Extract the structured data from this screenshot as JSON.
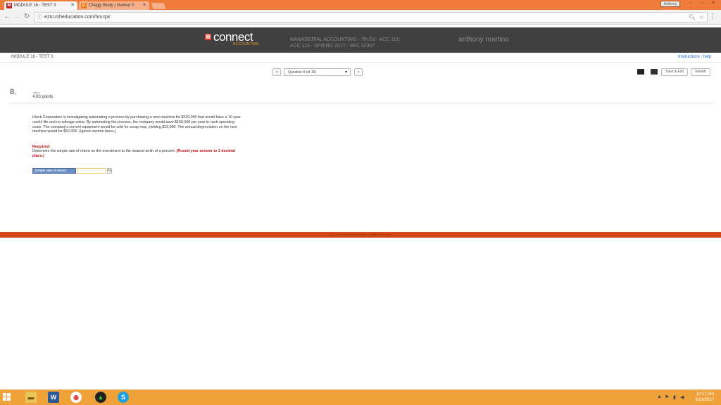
{
  "browser": {
    "tabs": [
      {
        "title": "MODULE 16 - TEST 3",
        "favicon": "M",
        "favicon_color": "#c81e1e",
        "active": true
      },
      {
        "title": "Chegg Study | Guided S",
        "favicon": "C",
        "favicon_color": "#f07c1a",
        "active": false
      }
    ],
    "user_label": "Anthony",
    "window_controls": {
      "minimize": "–",
      "maximize": "▫",
      "close": "✕"
    },
    "url": "ezto.mheducation.com/hm.tpx"
  },
  "header": {
    "logo_name": "connect",
    "logo_sub": "ACCOUNTING",
    "course_line1": "MANAGERIAL ACCOUNTING - 7th Ed - ACC 115:",
    "course_line2": "ACC 115 - SPRING 2017 - SEC 32307",
    "user_name": "anthony martino"
  },
  "subbar": {
    "module_title": "MODULE 16 - TEST 3",
    "instructions": "Instructions",
    "separator": " | ",
    "help": "help"
  },
  "qnav": {
    "prev": "‹",
    "next": "›",
    "selected": "Question 8 (of 15)",
    "save_exit": "Save & Exit",
    "submit": "Submit"
  },
  "question": {
    "number": "8.",
    "value_label": "value:",
    "points": "4.00 points",
    "text": "Hinck Corporation is investigating automating a process by purchasing a new machine for $520,000 that would have a 10 year useful life and no salvage value. By automating the process, the company would save $150,000 per year in cash operating costs. The company's current equipment would be sold for scrap now, yielding $15,000. The annual depreciation on the new machine would be $52,000. (Ignore income taxes.)",
    "required_label": "Required:",
    "required_text": "Determine the simple rate of return on the investment to the nearest tenth of a percent. ",
    "required_red": "(Round your answer to 1 decimal place.)",
    "answer_label": "Simple rate of return",
    "answer_value": "",
    "answer_unit": "%"
  },
  "footer": {
    "copyright": "©2017 McGraw-Hill Education. All rights reserved."
  },
  "taskbar": {
    "clock_time": "10:17 AM",
    "clock_date": "3/13/2017",
    "tray_up": "▲"
  },
  "colors": {
    "chrome_orange": "#f07c3c",
    "header_gray": "#404040",
    "footer_orange": "#d34a17",
    "taskbar_orange": "#f0a23a",
    "link_blue": "#1a66c4",
    "required_red": "#b01414"
  }
}
